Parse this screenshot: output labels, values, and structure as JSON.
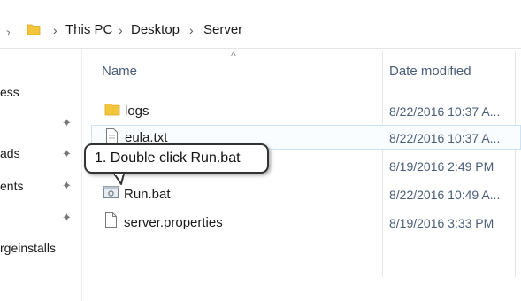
{
  "address_bar": {
    "breadcrumb": [
      "This PC",
      "Desktop",
      "Server"
    ],
    "separator": "›"
  },
  "nav_pane": {
    "items": [
      {
        "label": "ess",
        "pinned": false
      },
      {
        "label": "",
        "pinned": true
      },
      {
        "label": "ads",
        "pinned": true
      },
      {
        "label": "ents",
        "pinned": true
      },
      {
        "label": "",
        "pinned": true
      },
      {
        "label": "rgeinstalls",
        "pinned": false
      }
    ]
  },
  "columns": {
    "name": "Name",
    "date_modified": "Date modified",
    "sort_indicator": "^"
  },
  "files": [
    {
      "name": "logs",
      "date": "8/22/2016 10:37 A...",
      "icon": "folder-icon"
    },
    {
      "name": "eula.txt",
      "date": "8/22/2016 10:37 A...",
      "icon": "text-file-icon"
    },
    {
      "name": "",
      "date": "8/19/2016 2:49 PM",
      "icon": "file-icon"
    },
    {
      "name": "Run.bat",
      "date": "8/22/2016 10:49 A...",
      "icon": "batch-file-icon"
    },
    {
      "name": "server.properties",
      "date": "8/19/2016 3:33 PM",
      "icon": "file-icon"
    }
  ],
  "callout": {
    "text": "1. Double click Run.bat"
  },
  "colors": {
    "folder": "#f3c53a",
    "header_text": "#4a5d77",
    "selection_border": "#cde3f5"
  }
}
